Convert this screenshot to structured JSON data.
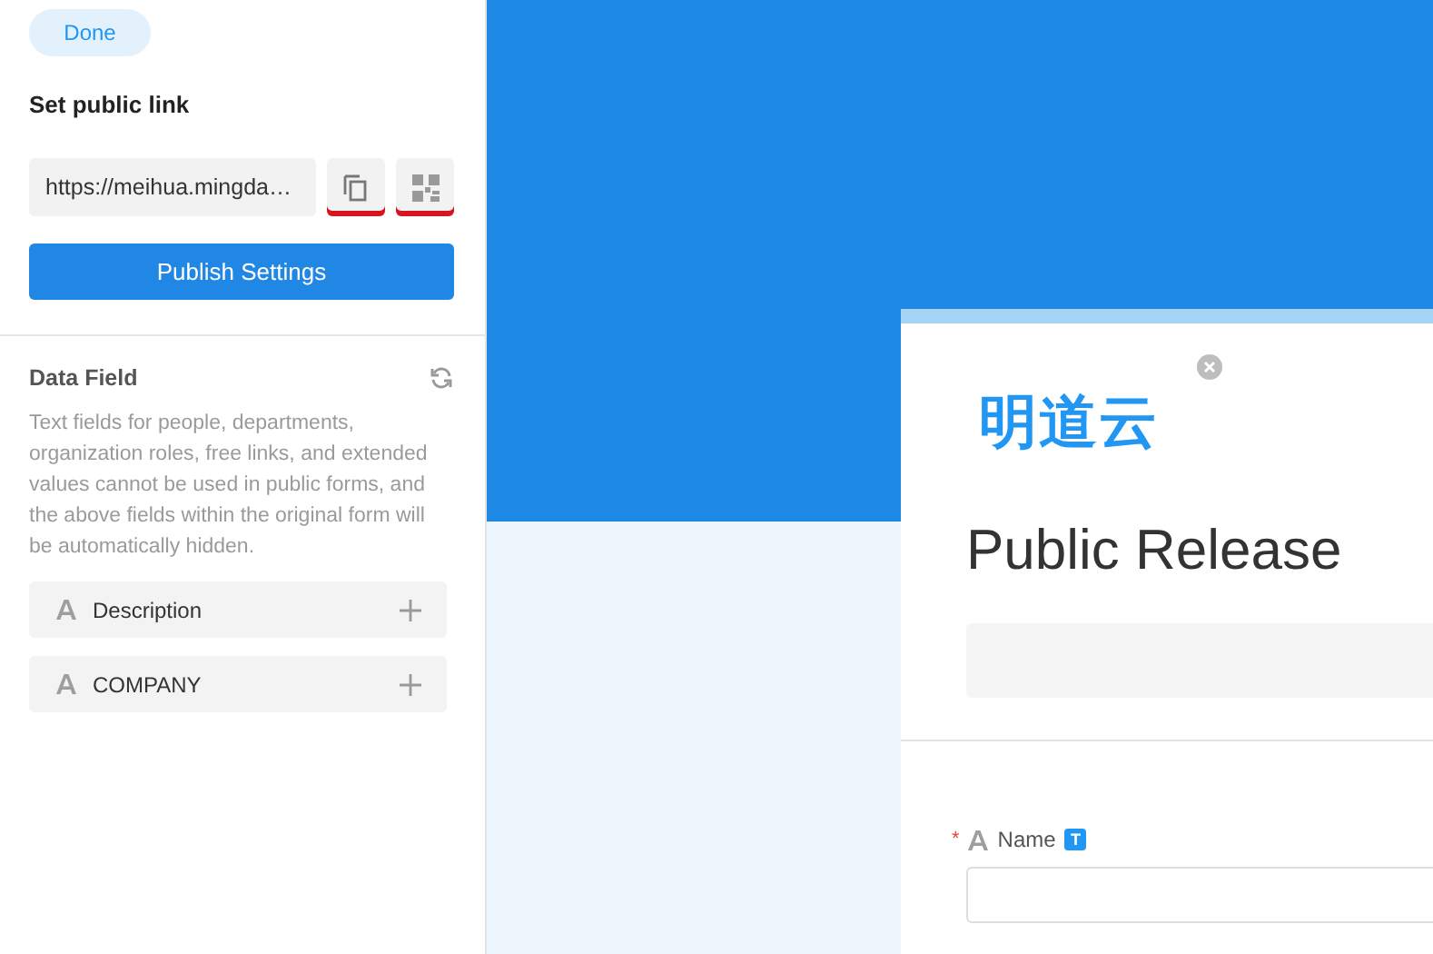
{
  "sidebar": {
    "done_button": "Done",
    "link_section": {
      "title": "Set public link",
      "url": "https://meihua.mingda…",
      "publish_button": "Publish Settings"
    },
    "data_field": {
      "title": "Data Field",
      "description": "Text fields for people, departments, organization roles, free links, and extended values cannot be used in public forms, and the above fields within the original form will be automatically hidden.",
      "items": [
        {
          "label": "Description"
        },
        {
          "label": "COMPANY"
        }
      ]
    }
  },
  "form_preview": {
    "logo": "明道云",
    "title": "Public Release",
    "fields": [
      {
        "label": "Name",
        "required": true,
        "required_mark": "*",
        "badge": "T"
      }
    ]
  }
}
